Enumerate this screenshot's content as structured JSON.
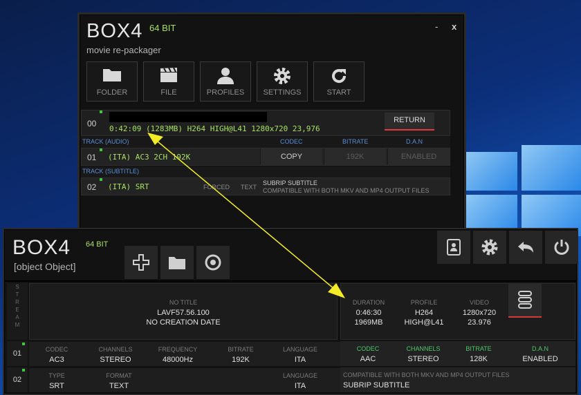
{
  "colors": {
    "accent_green": "#a8e063",
    "return_red": "#e23a3a",
    "label_blue": "#5a8ed8"
  },
  "old_window": {
    "brand": "BOX4",
    "bits": "64 BIT",
    "subtitle": "movie re-packager",
    "controls": {
      "minimize": "-",
      "close": "x"
    },
    "toolbar": [
      {
        "label": "FOLDER",
        "icon": "folder-icon"
      },
      {
        "label": "FILE",
        "icon": "clapperboard-icon"
      },
      {
        "label": "PROFILES",
        "icon": "user-icon"
      },
      {
        "label": "SETTINGS",
        "icon": "gear-icon"
      },
      {
        "label": "START",
        "icon": "refresh-icon"
      }
    ],
    "stream_row": {
      "index": "00",
      "info": "0:42:09 (1283MB) H264 HIGH@L41 1280x720 23,976",
      "return_label": "RETURN"
    },
    "audio_header": {
      "title": "TRACK (AUDIO)",
      "codec": "CODEC",
      "bitrate": "BITRATE",
      "dan": "D.A.N"
    },
    "audio_track": {
      "index": "01",
      "desc": "(ITA) AC3 2CH 192K",
      "codec": "COPY",
      "bitrate": "192K",
      "dan": "ENABLED"
    },
    "subtitle_header": {
      "title": "TRACK (SUBTITLE)"
    },
    "subtitle_track": {
      "index": "02",
      "desc": "(ITA) SRT",
      "forced": "FORCED",
      "text": "TEXT",
      "info_line1": "SUBRIP SUBTITLE",
      "info_line2": "COMPATIBLE WITH BOTH MKV AND MP4 OUTPUT FILES"
    }
  },
  "new_window": {
    "brand": "BOX4",
    "bits": "64 BIT",
    "subtitle": {
      "index": "02",
      "type_label": "TYPE",
      "type": "SRT",
      "format_label": "FORMAT",
      "format": "TEXT",
      "language_label": "LANGUAGE",
      "language": "ITA",
      "info_line1": "COMPATIBLE WITH BOTH MKV AND MP4 OUTPUT FILES",
      "info_line2": "SUBRIP SUBTITLE"
    },
    "left_icons": [
      "plus-icon",
      "folder-icon",
      "record-icon"
    ],
    "right_icons": [
      "contacts-icon",
      "gear-icon",
      "back-arrow-icon",
      "power-icon"
    ],
    "stream_label": [
      "S",
      "T",
      "R",
      "E",
      "A",
      "M"
    ],
    "stream": {
      "title": "NO TITLE",
      "app": "LAVF57.56.100",
      "date": "NO CREATION DATE",
      "duration_label": "DURATION",
      "duration": "0:46:30",
      "size": "1969MB",
      "profile_label": "PROFILE",
      "profile": "H264",
      "profile_level": "HIGH@L41",
      "video_label": "VIDEO",
      "video_res": "1280x720",
      "video_fps": "23.976"
    },
    "audio": {
      "index": "01",
      "codec_label": "CODEC",
      "codec": "AC3",
      "channels_label": "CHANNELS",
      "channels": "STEREO",
      "frequency_label": "FREQUENCY",
      "frequency": "48000Hz",
      "bitrate_label": "BITRATE",
      "bitrate": "192K",
      "language_label": "LANGUAGE",
      "language": "ITA",
      "out_codec_label": "CODEC",
      "out_codec": "AAC",
      "out_channels_label": "CHANNELS",
      "out_channels": "STEREO",
      "out_bitrate_label": "BITRATE",
      "out_bitrate": "128K",
      "dan_label": "D.A.N",
      "dan": "ENABLED"
    }
  }
}
